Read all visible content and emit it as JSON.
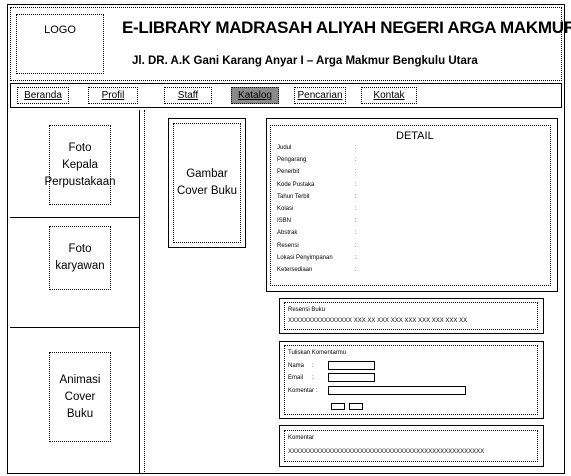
{
  "header": {
    "logo": "LOGO",
    "title": "E-LIBRARY MADRASAH ALIYAH NEGERI ARGA MAKMUR",
    "address": "Jl. DR. A.K Gani Karang Anyar I – Arga Makmur Bengkulu Utara"
  },
  "nav": {
    "items": [
      "Beranda",
      "Profil",
      "Staff",
      "Katalog",
      "Pencarian",
      "Kontak"
    ],
    "active": "Katalog"
  },
  "sidebar": {
    "box1_line1": "Foto Kepala",
    "box1_line2": "Perpustakaan",
    "box2_line1": "Foto",
    "box2_line2": "karyawan",
    "box3_line1": "Animasi",
    "box3_line2": "Cover Buku"
  },
  "cover": {
    "line1": "Gambar",
    "line2": "Cover Buku"
  },
  "detail": {
    "heading": "DETAIL",
    "fields": [
      "Judul",
      "Pengarang",
      "Penerbit",
      "Kode Pustaka",
      "Tahun Terbit",
      "Kolasi",
      "ISBN",
      "Abstrak",
      "Resensi",
      "Lokasi Penyimpanan",
      "Ketersediaan"
    ]
  },
  "resensi": {
    "label": "Resensi Buku",
    "text": "XXXXXXXXXXXXXXXX XXX XX XXX XXX XXX XXX XXX XXX XX"
  },
  "comment_form": {
    "label": "Tuliskan Komentarmu",
    "nama": "Nama",
    "email": "Email",
    "komentar": "Komentar"
  },
  "comments": {
    "label": "Komentar",
    "text": "XXXXXXXXXXXXXXXXXXXXXXXXXXXXXXXXXXXXXXXXXXXXXXXXX"
  }
}
